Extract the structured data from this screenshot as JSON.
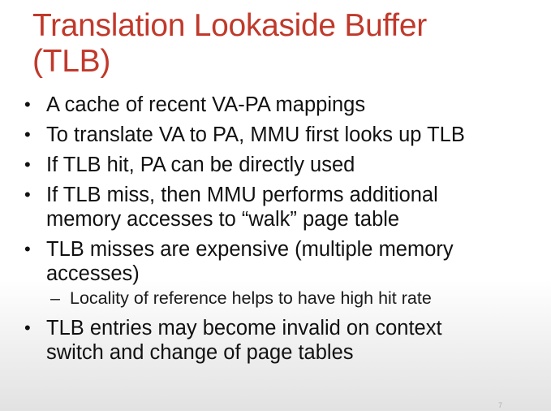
{
  "slide": {
    "title_line1": "Translation Lookaside Buffer",
    "title_line2": "(TLB)",
    "bullet_symbol": "•",
    "sub_bullet_symbol": "–",
    "bullets": [
      {
        "lines": [
          "A cache of recent VA-PA mappings"
        ]
      },
      {
        "lines": [
          "To translate VA to PA, MMU first looks up TLB"
        ]
      },
      {
        "lines": [
          "If TLB hit, PA can be directly used"
        ]
      },
      {
        "lines": [
          "If TLB miss, then MMU performs additional",
          "memory accesses to “walk” page table"
        ]
      },
      {
        "lines": [
          "TLB misses are expensive (multiple memory",
          "accesses)"
        ]
      },
      {
        "lines": [
          "TLB entries may become invalid on context",
          "switch and change of page tables"
        ]
      }
    ],
    "sub_bullets": [
      {
        "text": "Locality of reference helps to have high hit rate"
      }
    ],
    "page_number": "7"
  }
}
